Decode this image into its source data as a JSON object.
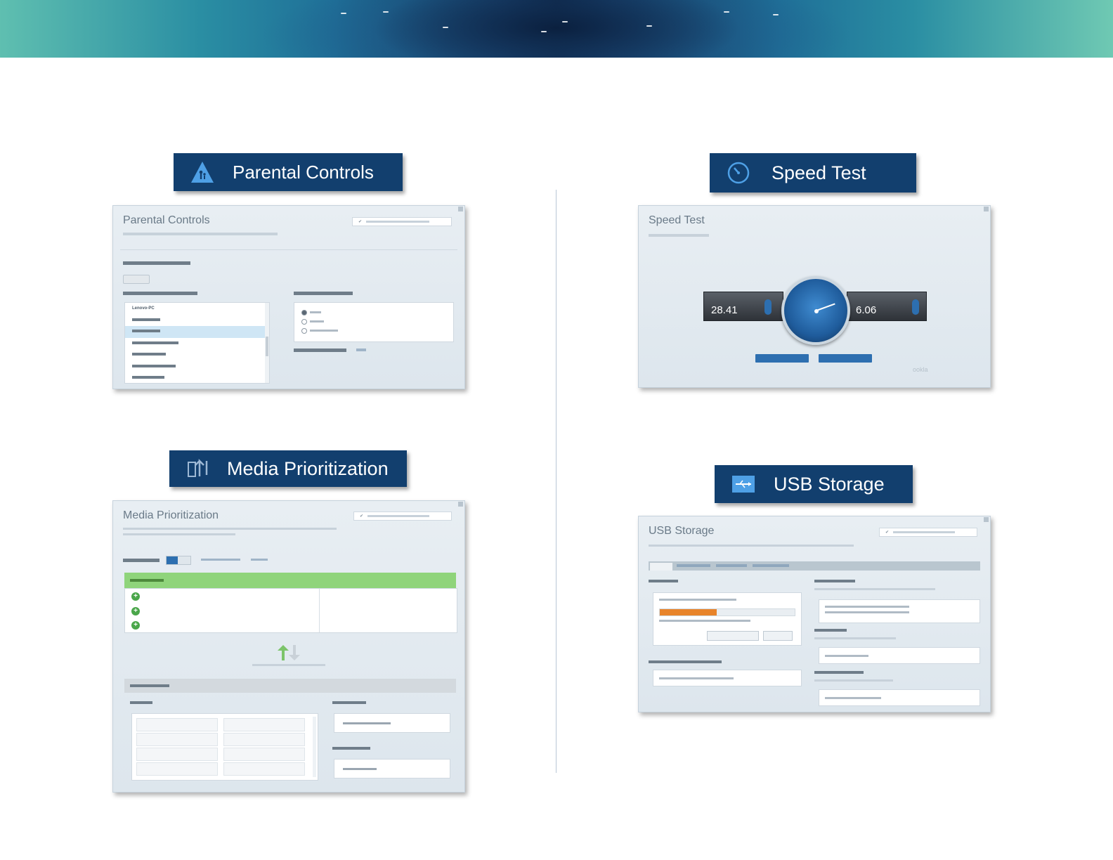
{
  "sections": {
    "parental": {
      "header": "Parental Controls",
      "icon": "parental-controls-icon",
      "panel": {
        "title": "Parental Controls",
        "list": [
          "Lenovo-PC",
          "",
          "",
          "",
          "",
          "",
          ""
        ]
      }
    },
    "speed": {
      "header": "Speed Test",
      "icon": "speedometer-icon",
      "panel": {
        "title": "Speed Test",
        "download": "28.41",
        "upload": "6.06"
      }
    },
    "media": {
      "header": "Media Prioritization",
      "icon": "media-prioritization-icon",
      "panel": {
        "title": "Media Prioritization"
      }
    },
    "usb": {
      "header": "USB Storage",
      "icon": "usb-icon",
      "panel": {
        "title": "USB Storage",
        "usb_progress": 0.42
      }
    }
  },
  "colors": {
    "header_bg": "#123f6e",
    "accent_blue": "#2d6fb0",
    "high_priority_green": "#8fd47b",
    "usb_bar_orange": "#e8842a"
  }
}
